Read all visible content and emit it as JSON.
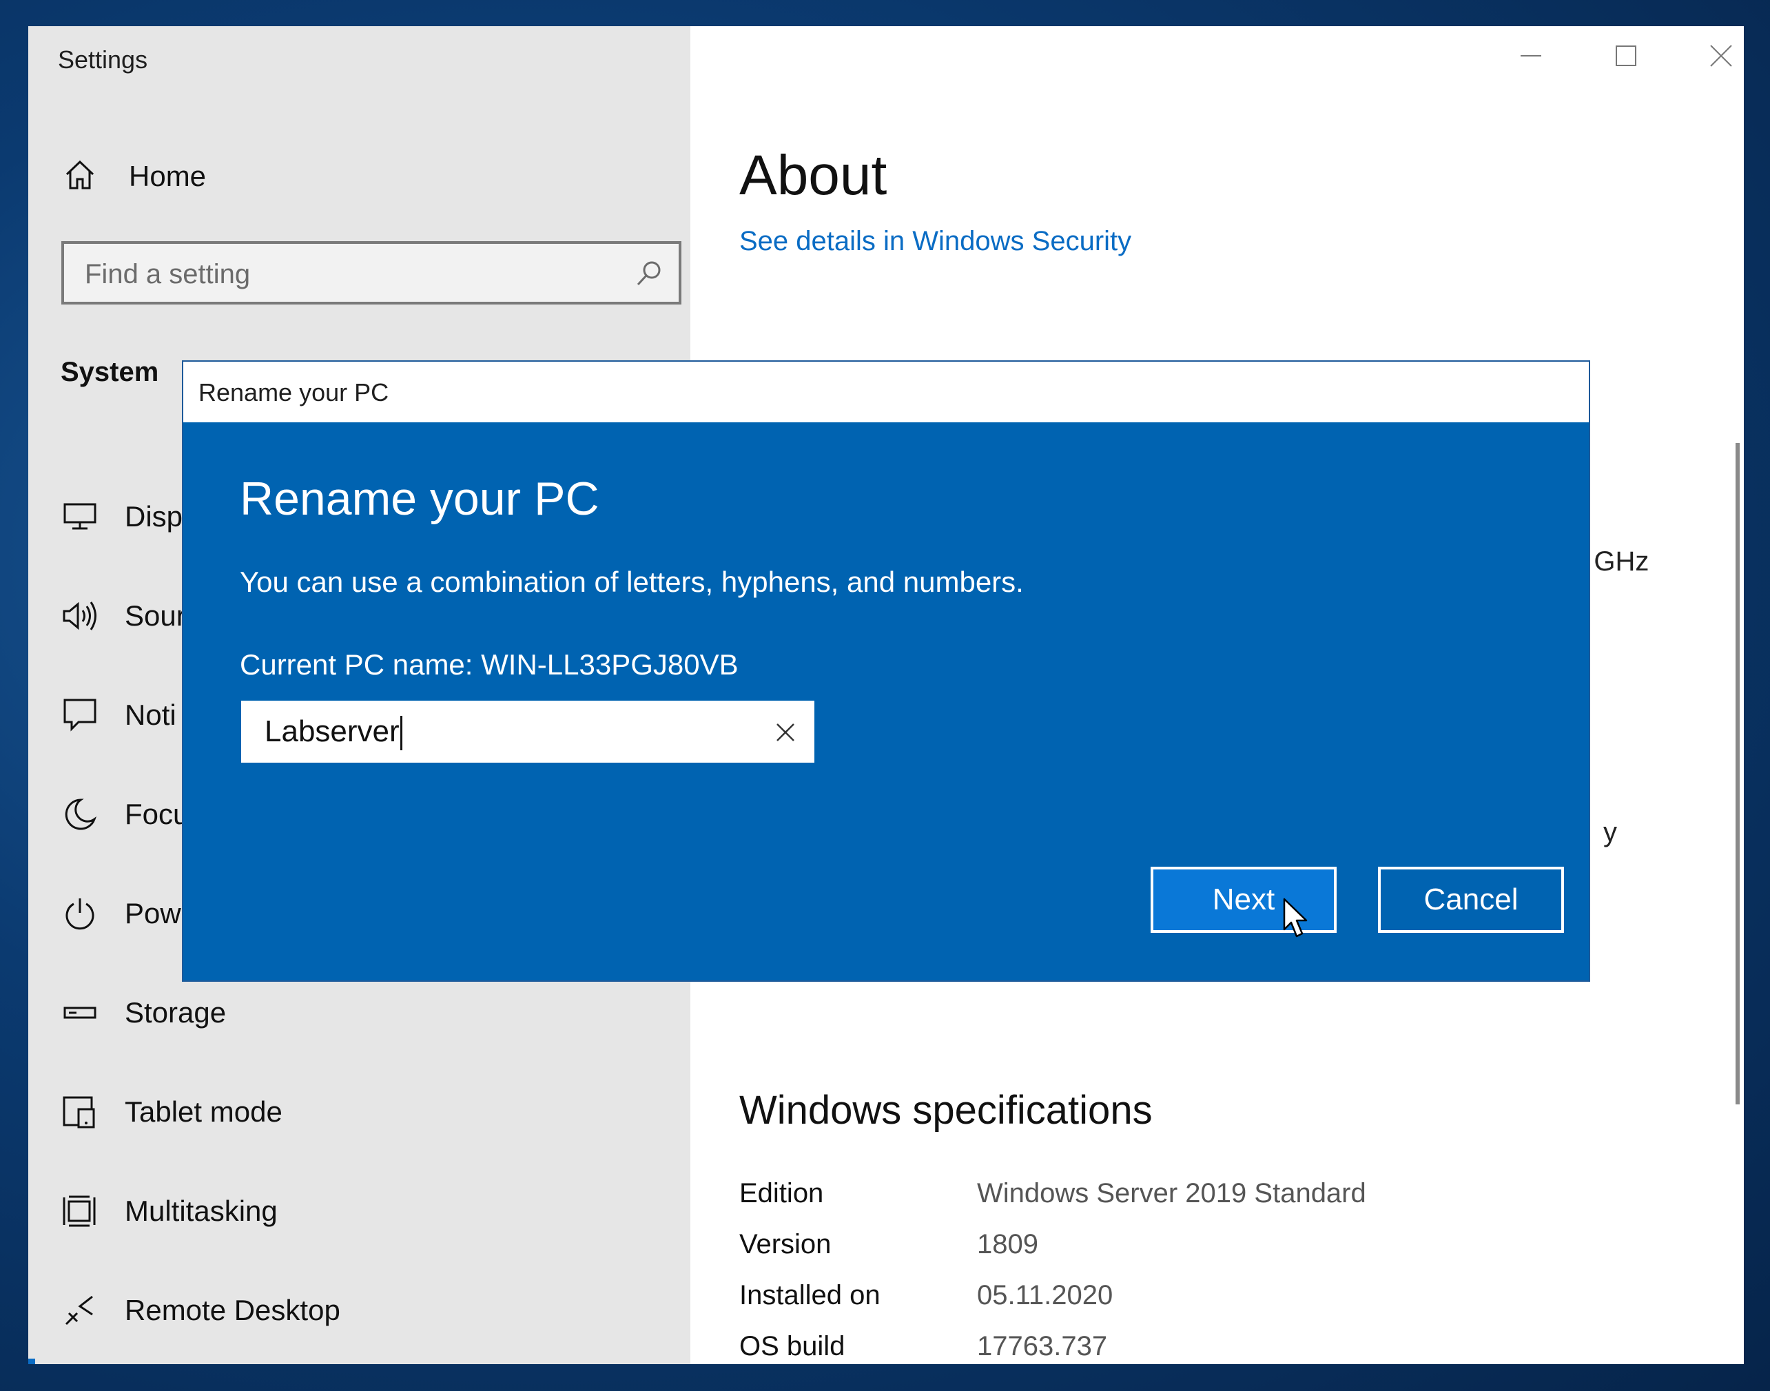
{
  "window": {
    "title": "Settings",
    "controls": {
      "minimize": "minimize-icon",
      "maximize": "maximize-icon",
      "close": "close-icon"
    }
  },
  "sidebar": {
    "home_label": "Home",
    "search_placeholder": "Find a setting",
    "section_title": "System",
    "items": [
      {
        "label": "Disp",
        "icon": "display-icon"
      },
      {
        "label": "Sour",
        "icon": "speaker-icon"
      },
      {
        "label": "Noti",
        "icon": "notifications-icon"
      },
      {
        "label": "Focu",
        "icon": "moon-icon"
      },
      {
        "label": "Powe",
        "icon": "power-icon"
      },
      {
        "label": "Storage",
        "icon": "storage-icon"
      },
      {
        "label": "Tablet mode",
        "icon": "tablet-icon"
      },
      {
        "label": "Multitasking",
        "icon": "multitasking-icon"
      },
      {
        "label": "Remote Desktop",
        "icon": "remote-desktop-icon"
      }
    ]
  },
  "content": {
    "page_title": "About",
    "security_link": "See details in Windows Security",
    "partial_ghz": ") GHz",
    "partial_y": "y",
    "specs_title": "Windows specifications",
    "specs": [
      {
        "key": "Edition",
        "value": "Windows Server 2019 Standard"
      },
      {
        "key": "Version",
        "value": "1809"
      },
      {
        "key": "Installed on",
        "value": "05.11.2020"
      },
      {
        "key": "OS build",
        "value": "17763.737"
      }
    ]
  },
  "dialog": {
    "window_title": "Rename your PC",
    "heading": "Rename your PC",
    "description": "You can use a combination of letters, hyphens, and numbers.",
    "current_name_text": "Current PC name: WIN-LL33PGJ80VB",
    "input_value": "Labserver",
    "next_label": "Next",
    "cancel_label": "Cancel"
  },
  "colors": {
    "dialog_bg": "#0063b1",
    "next_button_bg": "#0a78d7",
    "link": "#0a6cc4",
    "sidebar_bg": "#e6e6e6"
  }
}
